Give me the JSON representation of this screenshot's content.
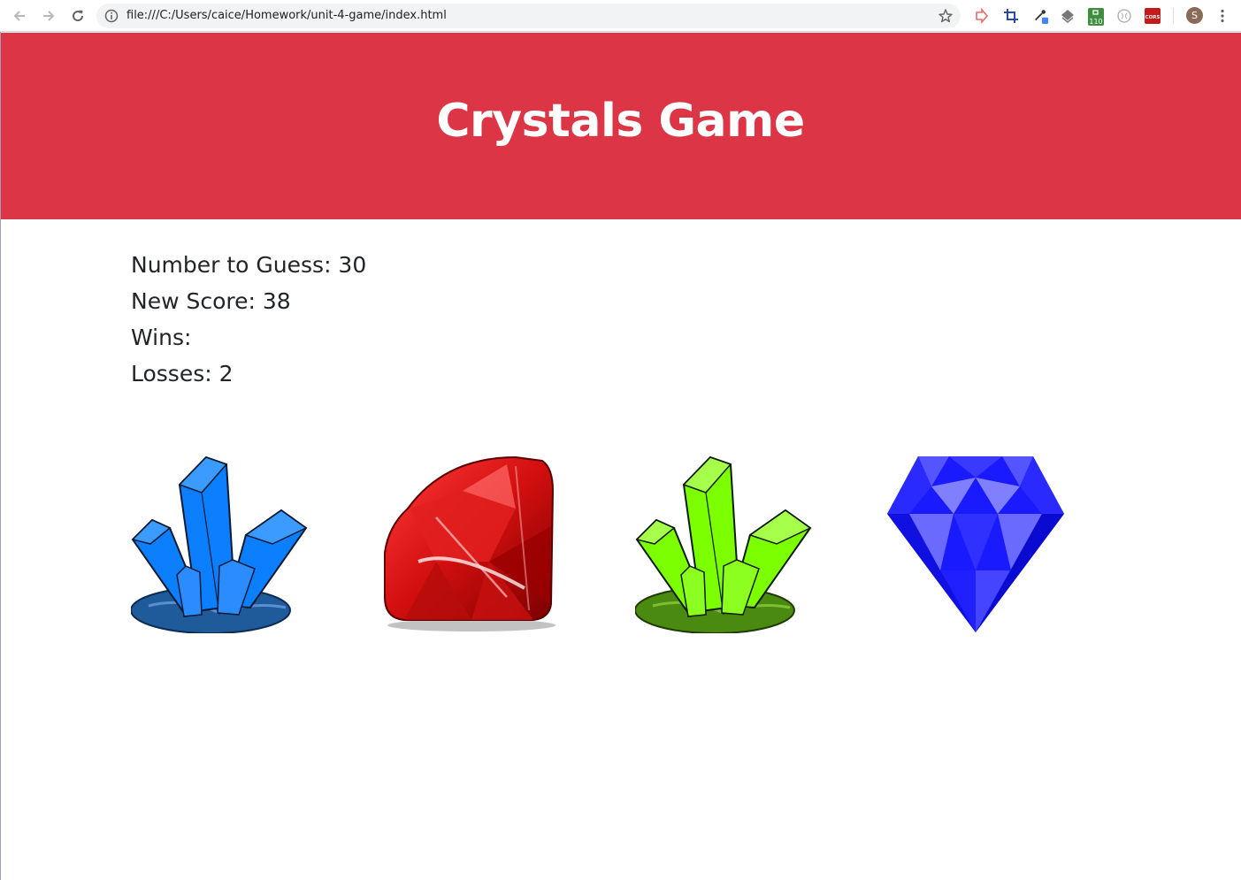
{
  "browser": {
    "url": "file:///C:/Users/caice/Homework/unit-4-game/index.html",
    "extensions": [
      "share-arrow-icon",
      "crop-icon",
      "eyedropper-icon",
      "layers-icon",
      "counter-extension-icon",
      "circle-extension-icon",
      "cors-extension-icon"
    ],
    "counter_badge": "110",
    "cors_label": "CORS",
    "profile_initial": "S"
  },
  "page": {
    "title": "Crystals Game",
    "number_to_guess": "Number to Guess: 30",
    "new_score": "New Score: 38",
    "wins": "Wins:",
    "losses": "Losses: 2"
  },
  "crystals": [
    {
      "name": "blue-crystal-cluster",
      "color": "#0b7fff"
    },
    {
      "name": "red-ruby",
      "color": "#d20f0f"
    },
    {
      "name": "green-crystal-cluster",
      "color": "#7cff00"
    },
    {
      "name": "blue-diamond",
      "color": "#1a1aff"
    }
  ],
  "colors": {
    "header_bg": "#dc3545",
    "header_text": "#ffffff",
    "body_text": "#212529"
  }
}
